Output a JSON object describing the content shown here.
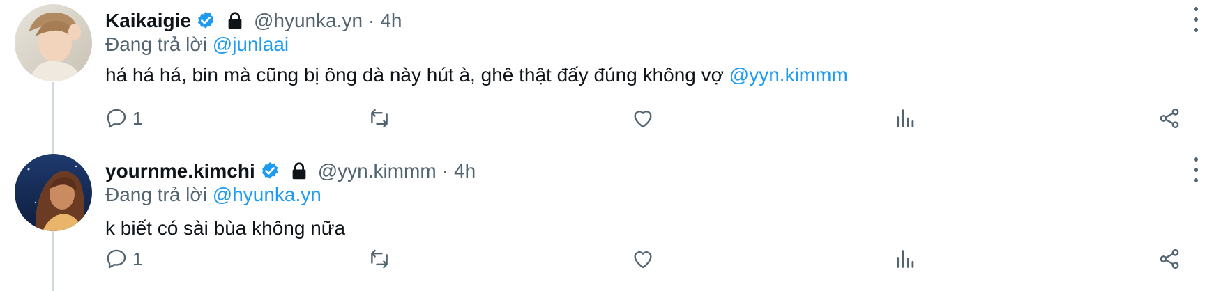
{
  "tweets": [
    {
      "display_name": "Kaikaigie",
      "handle": "@hyunka.yn",
      "separator": "·",
      "time": "4h",
      "reply_prefix": "Đang trả lời ",
      "reply_to": "@junlaai",
      "text": "há há há, bin mà cũng bị ông dà này hút à, ghê thật đấy đúng không vợ ",
      "text_mention": "@yyn.kimmm",
      "reply_count": "1",
      "verified": true,
      "locked": true
    },
    {
      "display_name": "yournme.kimchi",
      "handle": "@yyn.kimmm",
      "separator": "·",
      "time": "4h",
      "reply_prefix": "Đang trả lời ",
      "reply_to": "@hyunka.yn",
      "text": "k biết có sài bùa không nữa",
      "text_mention": "",
      "reply_count": "1",
      "verified": true,
      "locked": true
    }
  ],
  "icons": {
    "reply": "reply-icon",
    "retweet": "retweet-icon",
    "like": "heart-icon",
    "views": "views-icon",
    "share": "share-icon",
    "more": "more-vertical-icon",
    "verified": "verified-badge-icon",
    "lock": "lock-icon"
  },
  "colors": {
    "link": "#1d9bf0",
    "secondary_text": "#536471",
    "primary_text": "#0f1419",
    "verified": "#1d9bf0",
    "thread_line": "#cfd9de"
  }
}
